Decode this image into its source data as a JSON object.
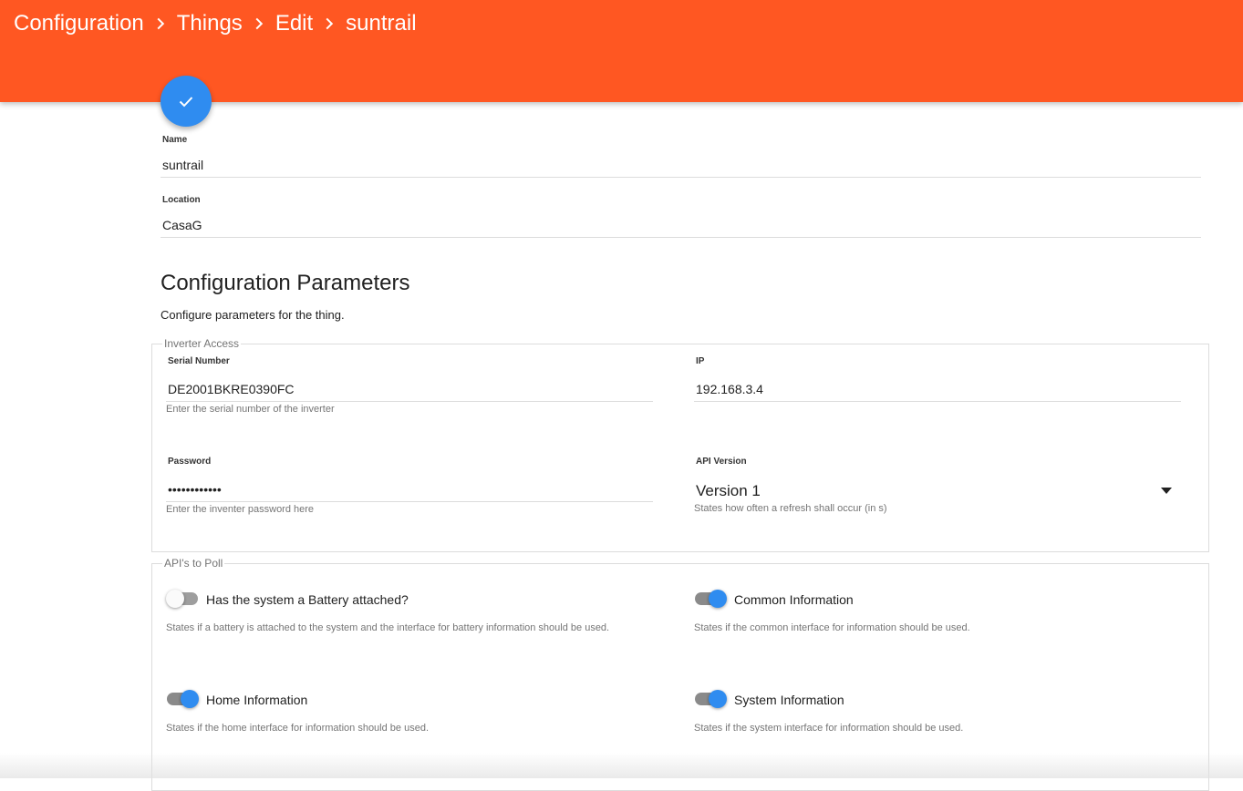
{
  "breadcrumb": [
    "Configuration",
    "Things",
    "Edit",
    "suntrail"
  ],
  "fab": {
    "icon": "check-icon",
    "color": "#2f8cf0"
  },
  "colors": {
    "appbar": "#ff5722",
    "accent": "#2f8cf0"
  },
  "name": {
    "label": "Name",
    "value": "suntrail"
  },
  "location": {
    "label": "Location",
    "value": "CasaG"
  },
  "config": {
    "title": "Configuration Parameters",
    "description": "Configure parameters for the thing."
  },
  "inverter_access": {
    "legend": "Inverter Access",
    "serial": {
      "label": "Serial Number",
      "value": "DE2001BKRE0390FC",
      "hint": "Enter the serial number of the inverter"
    },
    "ip": {
      "label": "IP",
      "value": "192.168.3.4"
    },
    "password": {
      "label": "Password",
      "value": "••••••••••••",
      "hint": "Enter the inventer password here"
    },
    "api_version": {
      "label": "API Version",
      "value": "Version 1",
      "hint": "States how often a refresh shall occur (in s)"
    }
  },
  "apis_to_poll": {
    "legend": "API's to Poll",
    "battery": {
      "label": "Has the system a Battery attached?",
      "hint": "States if a battery is attached to the system and the interface for battery information should be used.",
      "enabled": false
    },
    "common": {
      "label": "Common Information",
      "hint": "States if the common interface for information should be used.",
      "enabled": true
    },
    "home": {
      "label": "Home Information",
      "hint": "States if the home interface for information should be used.",
      "enabled": true
    },
    "system": {
      "label": "System Information",
      "hint": "States if the system interface for information should be used.",
      "enabled": true
    }
  }
}
